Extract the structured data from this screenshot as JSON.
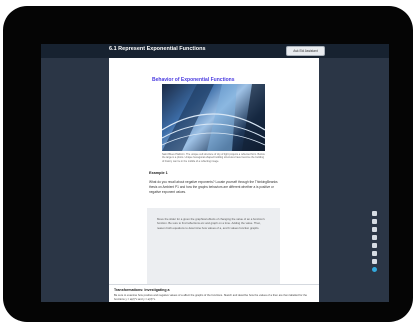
{
  "header": {
    "title": "6.1 Represent Exponential Functions",
    "button_label": "Ask Eid Assistant"
  },
  "section": {
    "title": "Behavior of Exponential Functions",
    "photo_caption": "Saint Blues Platform. The unique cell structure of city of light projects a reflected form. Before the large is a photo. Unique hexagonal-shaped building structures have become the building of history can be in the middle of a reflecting image."
  },
  "example": {
    "label": "Example 1",
    "text": "What do you recall about negative exponents? Locate yourself through the ThinkingBeanks thesis on Ambient P1 and how the graphs behaviors are different whether a is positive or negative exponent values."
  },
  "graybox": {
    "text": "Move the slider for a given the graphical effects of changing the value of an a function's function. Be sure to find reflections etc and graph on a time. Adding the value. Then, reason both equations to determine how values of a, and b values function graphs.",
    "button_label": "@ExploringDesmos"
  },
  "bottom": {
    "title": "Transformations: Investigating a",
    "text": "Be sure to examine how positive and negative values of a affect the graphs of the functions. Sketch and describe how the values of a then are then labelled for the functions y = a(2)^x and y = a(3)^x."
  },
  "rail_icons": [
    "search-icon",
    "pencil-icon",
    "print-icon",
    "bookmark-icon",
    "text-icon",
    "copy-icon",
    "audio-icon",
    "chat-icon"
  ]
}
